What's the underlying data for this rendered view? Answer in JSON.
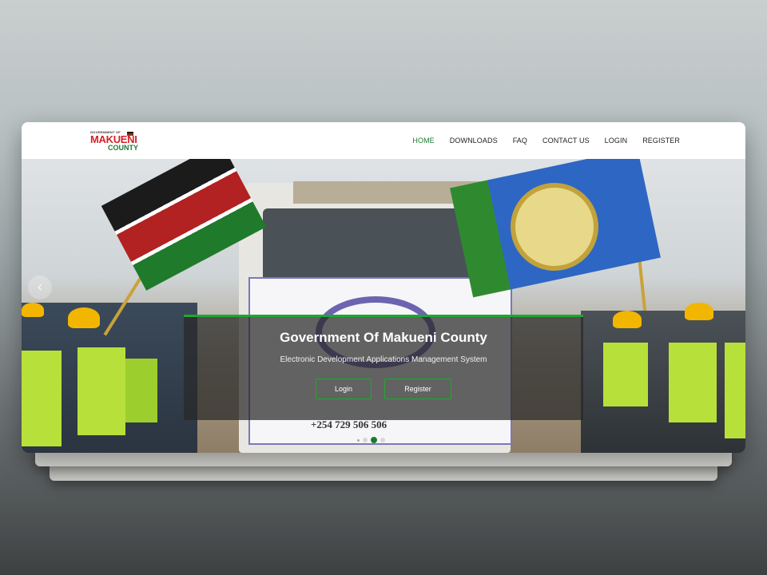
{
  "logo": {
    "small_text": "GOVERNMENT OF",
    "name_line1": "MAKUENI",
    "name_line2": "COUNTY"
  },
  "nav": {
    "items": [
      {
        "label": "HOME",
        "active": true
      },
      {
        "label": "DOWNLOADS",
        "active": false
      },
      {
        "label": "FAQ",
        "active": false
      },
      {
        "label": "CONTACT US",
        "active": false
      },
      {
        "label": "LOGIN",
        "active": false
      },
      {
        "label": "REGISTER",
        "active": false
      }
    ]
  },
  "hero": {
    "title": "Government Of Makueni County",
    "subtitle": "Electronic Development Applications Management System",
    "login_label": "Login",
    "register_label": "Register",
    "banner_phone": "+254 729 506 506",
    "slide_count": 3,
    "active_slide": 2
  },
  "colors": {
    "accent_green": "#1d7a35",
    "button_border": "#1fa82f",
    "logo_red": "#d2232a"
  },
  "icons": {
    "prev": "chevron-left-icon"
  }
}
